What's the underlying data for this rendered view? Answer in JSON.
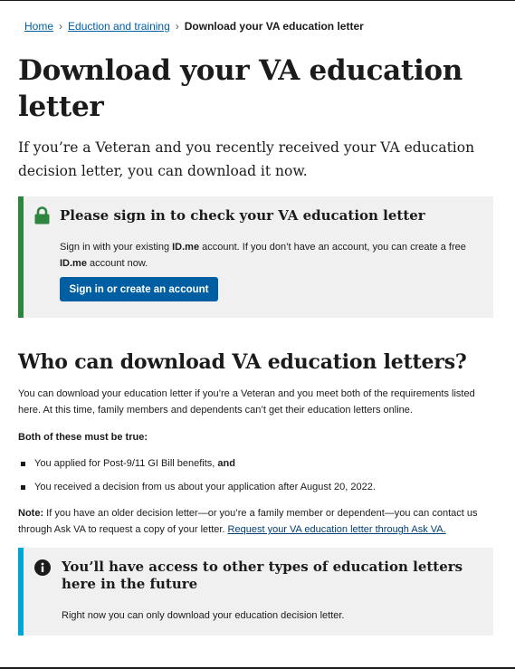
{
  "breadcrumb": {
    "items": [
      "Home",
      "Eduction and training"
    ],
    "separator": "›",
    "current": "Download your VA education letter"
  },
  "page_title": "Download your VA education letter",
  "lead": "If you’re a Veteran and you recently received your VA education decision letter, you can download it now.",
  "signin_alert": {
    "icon": "lock-icon",
    "color": "#2e8540",
    "title": "Please sign in to check your VA education letter",
    "body_part1": "Sign in with your existing ",
    "idme_1": "ID.me",
    "body_part2": " account. If you don’t have an account, you can create a free ",
    "idme_2": "ID.me",
    "body_part3": " account now.",
    "button_label": "Sign in or create an account"
  },
  "who_section": {
    "title": "Who can download VA education letters?",
    "intro": "You can download your education letter if you’re a Veteran and you meet both of the requirements listed here. At this time, family members and dependents can’t get their education letters online.",
    "requirements_heading": "Both of these must be true:",
    "req1_text": "You applied for Post-9/11 GI Bill benefits, ",
    "req1_bold": "and",
    "req2_text": "You received a decision from us about your application after August 20, 2022.",
    "note_label": "Note:",
    "note_text": " If you have an older decision letter—or you’re a family member or dependent—you can contact us through Ask VA to request a copy of your letter. ",
    "note_link": "Request your VA education letter through Ask VA."
  },
  "info_alert": {
    "icon": "info-circle-icon",
    "color": "#00a6d2",
    "title": "You’ll have access to other types of education letters here in the future",
    "body": "Right now you can only download your education decision letter."
  }
}
